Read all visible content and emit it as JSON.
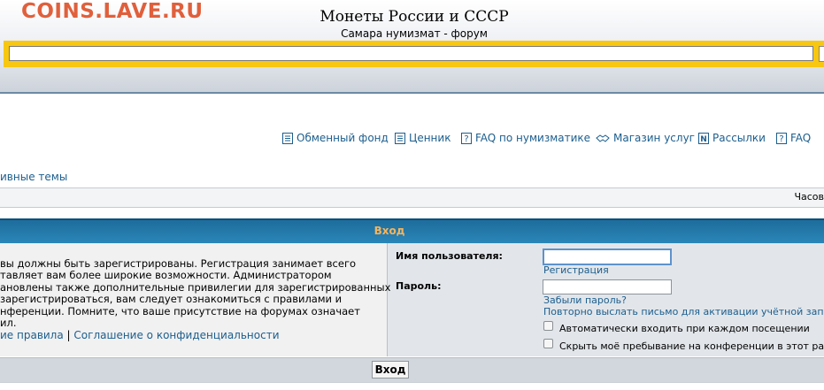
{
  "header": {
    "logo": "COINS.LAVE.RU",
    "title": "Монеты России и СССР",
    "subtitle": "Самара нумизмат - форум"
  },
  "nav": {
    "items": [
      {
        "label": "Обменный фонд",
        "icon": "list-icon"
      },
      {
        "label": "Ценник",
        "icon": "list-icon"
      },
      {
        "label": "FAQ по нумизматике",
        "icon": "question-icon"
      },
      {
        "label": "Магазин услуг",
        "icon": "handshake-icon"
      },
      {
        "label": "Рассылки",
        "icon": "newsletter-icon"
      },
      {
        "label": "FAQ",
        "icon": "question-icon"
      }
    ],
    "active_topics": "ивные темы"
  },
  "timezone": "Часов",
  "login": {
    "title": "Вход",
    "info_lines": [
      "вы должны быть зарегистрированы. Регистрация занимает всего",
      "тавляет вам более широкие возможности. Администратором",
      "ановлены также дополнительные привилегии для зарегистрированных",
      "зарегистрироваться, вам следует ознакомиться с правилами и",
      "нференции. Помните, что ваше присутствие на форумах означает",
      "ил."
    ],
    "rules_link": "ие правила",
    "separator": "|",
    "privacy_link": "Соглашение о конфиденциальности",
    "username_label": "Имя пользователя:",
    "username_value": "",
    "register_link": "Регистрация",
    "password_label": "Пароль:",
    "password_value": "",
    "forgot_link": "Забыли пароль?",
    "resend_link": "Повторно выслать письмо для активации учётной записи",
    "auto_login_label": "Автоматически входить при каждом посещении",
    "hide_online_label": "Скрыть моё пребывание на конференции в этот раз",
    "submit_label": "Вход"
  },
  "colors": {
    "logo": "#e0603c",
    "search_band": "#f7c711",
    "link": "#1c5e8e",
    "login_header": "#2a86b8",
    "login_title": "#f6b45c"
  }
}
